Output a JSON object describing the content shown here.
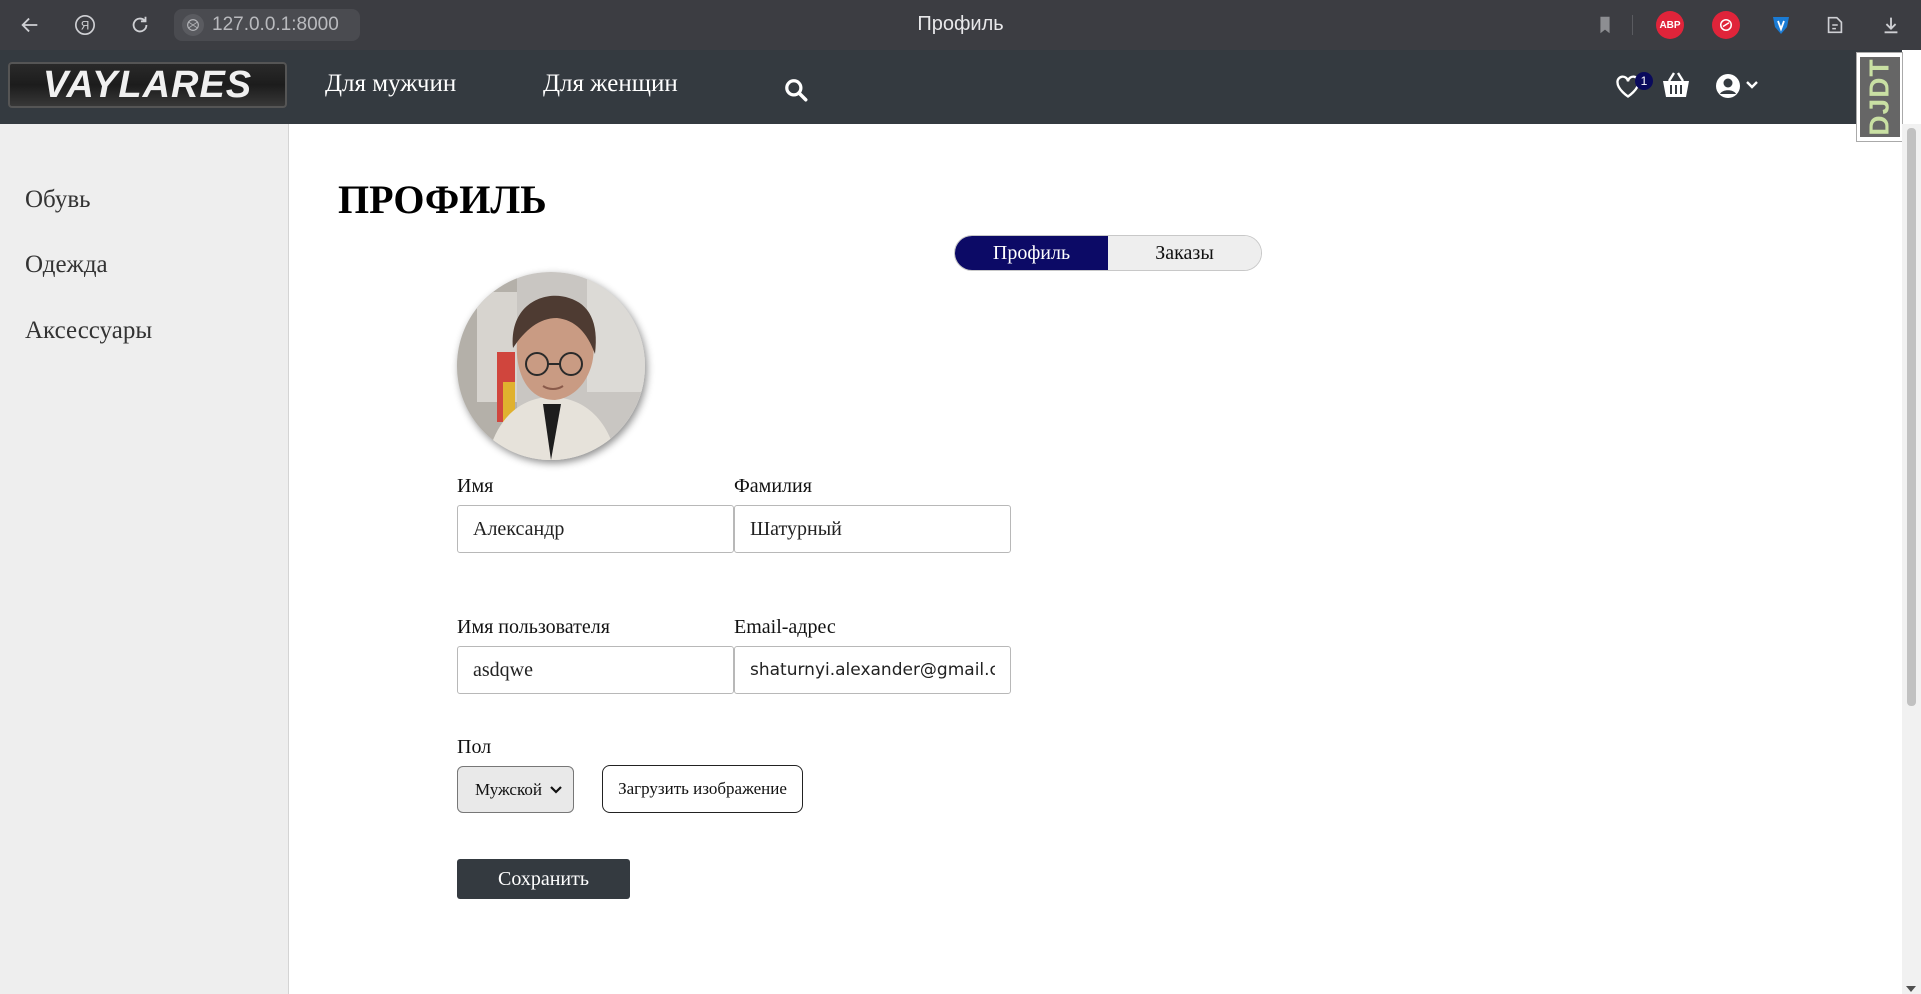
{
  "browser": {
    "url": "127.0.0.1:8000",
    "tab_title": "Профиль",
    "extensions": [
      "bookmark-icon",
      "adblock-icon",
      "extension-red-icon",
      "extension-shield-icon",
      "extension-puzzle-icon",
      "download-icon"
    ],
    "abp_label": "ABP"
  },
  "header": {
    "logo_text": "VAYLARES",
    "nav": [
      {
        "label": "Для мужчин"
      },
      {
        "label": "Для женщин"
      }
    ],
    "wishlist_count": "1",
    "debug_toolbar_label": "DJDT"
  },
  "sidebar": {
    "items": [
      {
        "label": "Обувь"
      },
      {
        "label": "Одежда"
      },
      {
        "label": "Аксессуары"
      }
    ]
  },
  "main": {
    "title": "ПРОФИЛЬ",
    "tabs": [
      {
        "label": "Профиль",
        "active": true
      },
      {
        "label": "Заказы",
        "active": false
      }
    ],
    "form": {
      "first_name_label": "Имя",
      "first_name_value": "Александр",
      "last_name_label": "Фамилия",
      "last_name_value": "Шатурный",
      "username_label": "Имя пользователя",
      "username_value": "asdqwe",
      "email_label": "Email-адрес",
      "email_value": "shaturnyi.alexander@gmail.com",
      "gender_label": "Пол",
      "gender_value": "Мужской",
      "upload_label": "Загрузить изображение",
      "save_label": "Сохранить"
    }
  },
  "colors": {
    "header_bg": "#343a40",
    "browser_bg": "#3c3d42",
    "tab_active": "#0c0a66",
    "sidebar_bg": "#eeeeee",
    "save_bg": "#343a40"
  }
}
